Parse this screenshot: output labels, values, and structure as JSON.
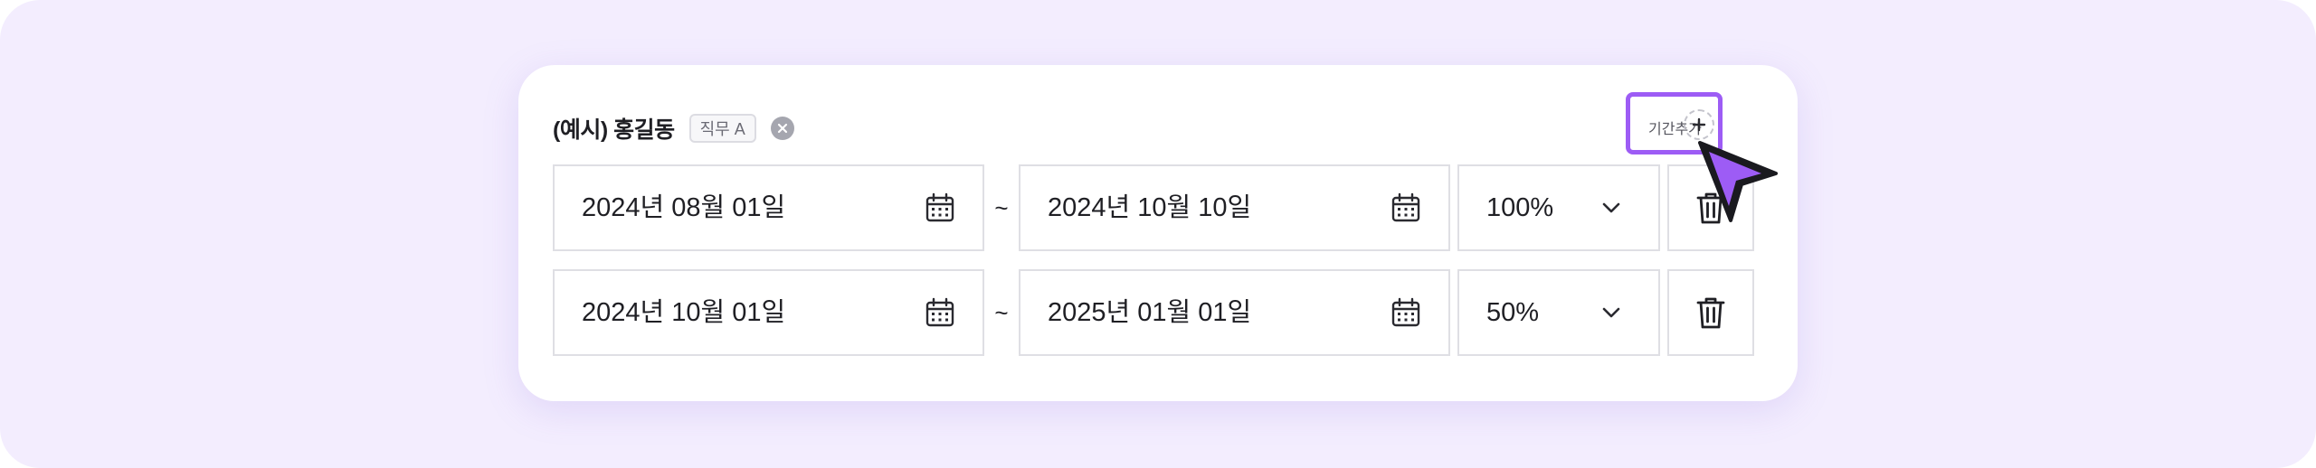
{
  "person": {
    "name": "(예시) 홍길동",
    "role_badge": "직무 A"
  },
  "add_period": {
    "label": "기간추가"
  },
  "periods": [
    {
      "start_date": "2024년 08월 01일",
      "separator": "~",
      "end_date": "2024년 10월 10일",
      "ratio": "100%"
    },
    {
      "start_date": "2024년 10월 01일",
      "separator": "~",
      "end_date": "2025년 01월 01일",
      "ratio": "50%"
    }
  ],
  "icons": {
    "remove": "close-circle-icon",
    "add": "plus-icon",
    "date": "calendar-icon",
    "dropdown": "chevron-down-icon",
    "delete": "trash-icon",
    "pointer": "cursor-arrow-icon"
  },
  "colors": {
    "background": "#f3edfe",
    "accent": "#9d5cf5",
    "border": "#dfdfe4",
    "text": "#1f1f24"
  }
}
